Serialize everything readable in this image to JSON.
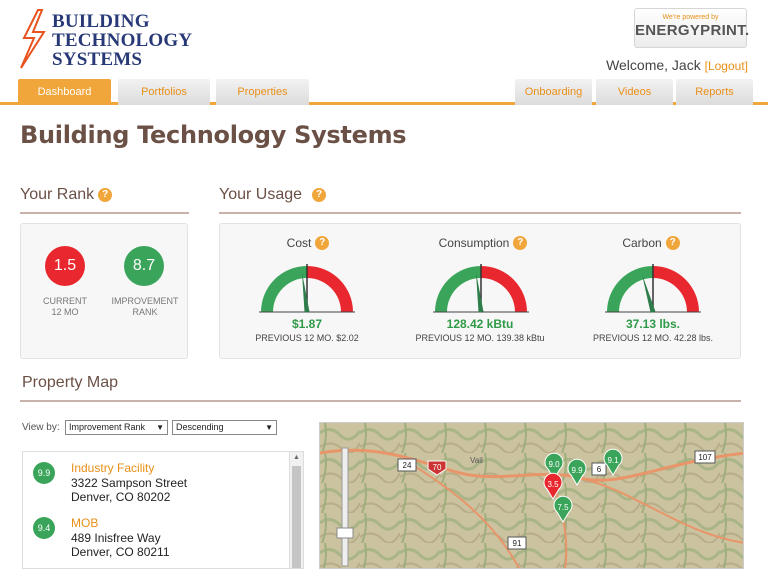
{
  "brand": {
    "logo_lines": [
      "BUILDING",
      "TECHNOLOGY",
      "SYSTEMS"
    ],
    "powered_small": "We're powered by",
    "powered_brand": "ENERGYPRINT."
  },
  "user": {
    "welcome": "Welcome, Jack",
    "logout": "[Logout]"
  },
  "tabs_left": [
    {
      "label": "Dashboard",
      "active": true
    },
    {
      "label": "Portfolios",
      "active": false
    },
    {
      "label": "Properties",
      "active": false
    }
  ],
  "tabs_right": [
    {
      "label": "Onboarding"
    },
    {
      "label": "Videos"
    },
    {
      "label": "Reports"
    }
  ],
  "page_title": "Building Technology Systems",
  "rank": {
    "title": "Your Rank",
    "current": {
      "value": "1.5",
      "caption": "CURRENT\n12 MO",
      "color": "#e8282e"
    },
    "improvement": {
      "value": "8.7",
      "caption": "IMPROVEMENT\nRANK",
      "color": "#3aa55a"
    }
  },
  "usage": {
    "title": "Your Usage",
    "gauges": [
      {
        "title": "Cost",
        "value": "$1.87",
        "prev": "PREVIOUS 12 MO. $2.02",
        "fraction": 0.46
      },
      {
        "title": "Consumption",
        "value": "128.42 kBtu",
        "prev": "PREVIOUS 12 MO. 139.38 kBtu",
        "fraction": 0.46
      },
      {
        "title": "Carbon",
        "value": "37.13 lbs.",
        "prev": "PREVIOUS 12 MO. 42.28 lbs.",
        "fraction": 0.41
      }
    ]
  },
  "map": {
    "title": "Property Map",
    "view_by_label": "View by:",
    "view_by_value": "Improvement Rank",
    "order_value": "Descending",
    "road_labels": [
      "24",
      "70",
      "Vail",
      "91",
      "6",
      "107"
    ],
    "markers": [
      {
        "value": "9.0",
        "color": "#3aa55a"
      },
      {
        "value": "9.9",
        "color": "#3aa55a"
      },
      {
        "value": "9.1",
        "color": "#3aa55a"
      },
      {
        "value": "3.5",
        "color": "#e8282e"
      },
      {
        "value": "7.5",
        "color": "#3aa55a"
      }
    ]
  },
  "properties": [
    {
      "rank": "9.9",
      "name": "Industry Facility",
      "address1": "3322 Sampson Street",
      "address2": "Denver, CO 80202"
    },
    {
      "rank": "9.4",
      "name": "MOB",
      "address1": "489 Inisfree Way",
      "address2": "Denver, CO 80211"
    }
  ],
  "colors": {
    "accent": "#f0a63b",
    "brand": "#283977",
    "good": "#3aa55a",
    "bad": "#e8282e"
  }
}
